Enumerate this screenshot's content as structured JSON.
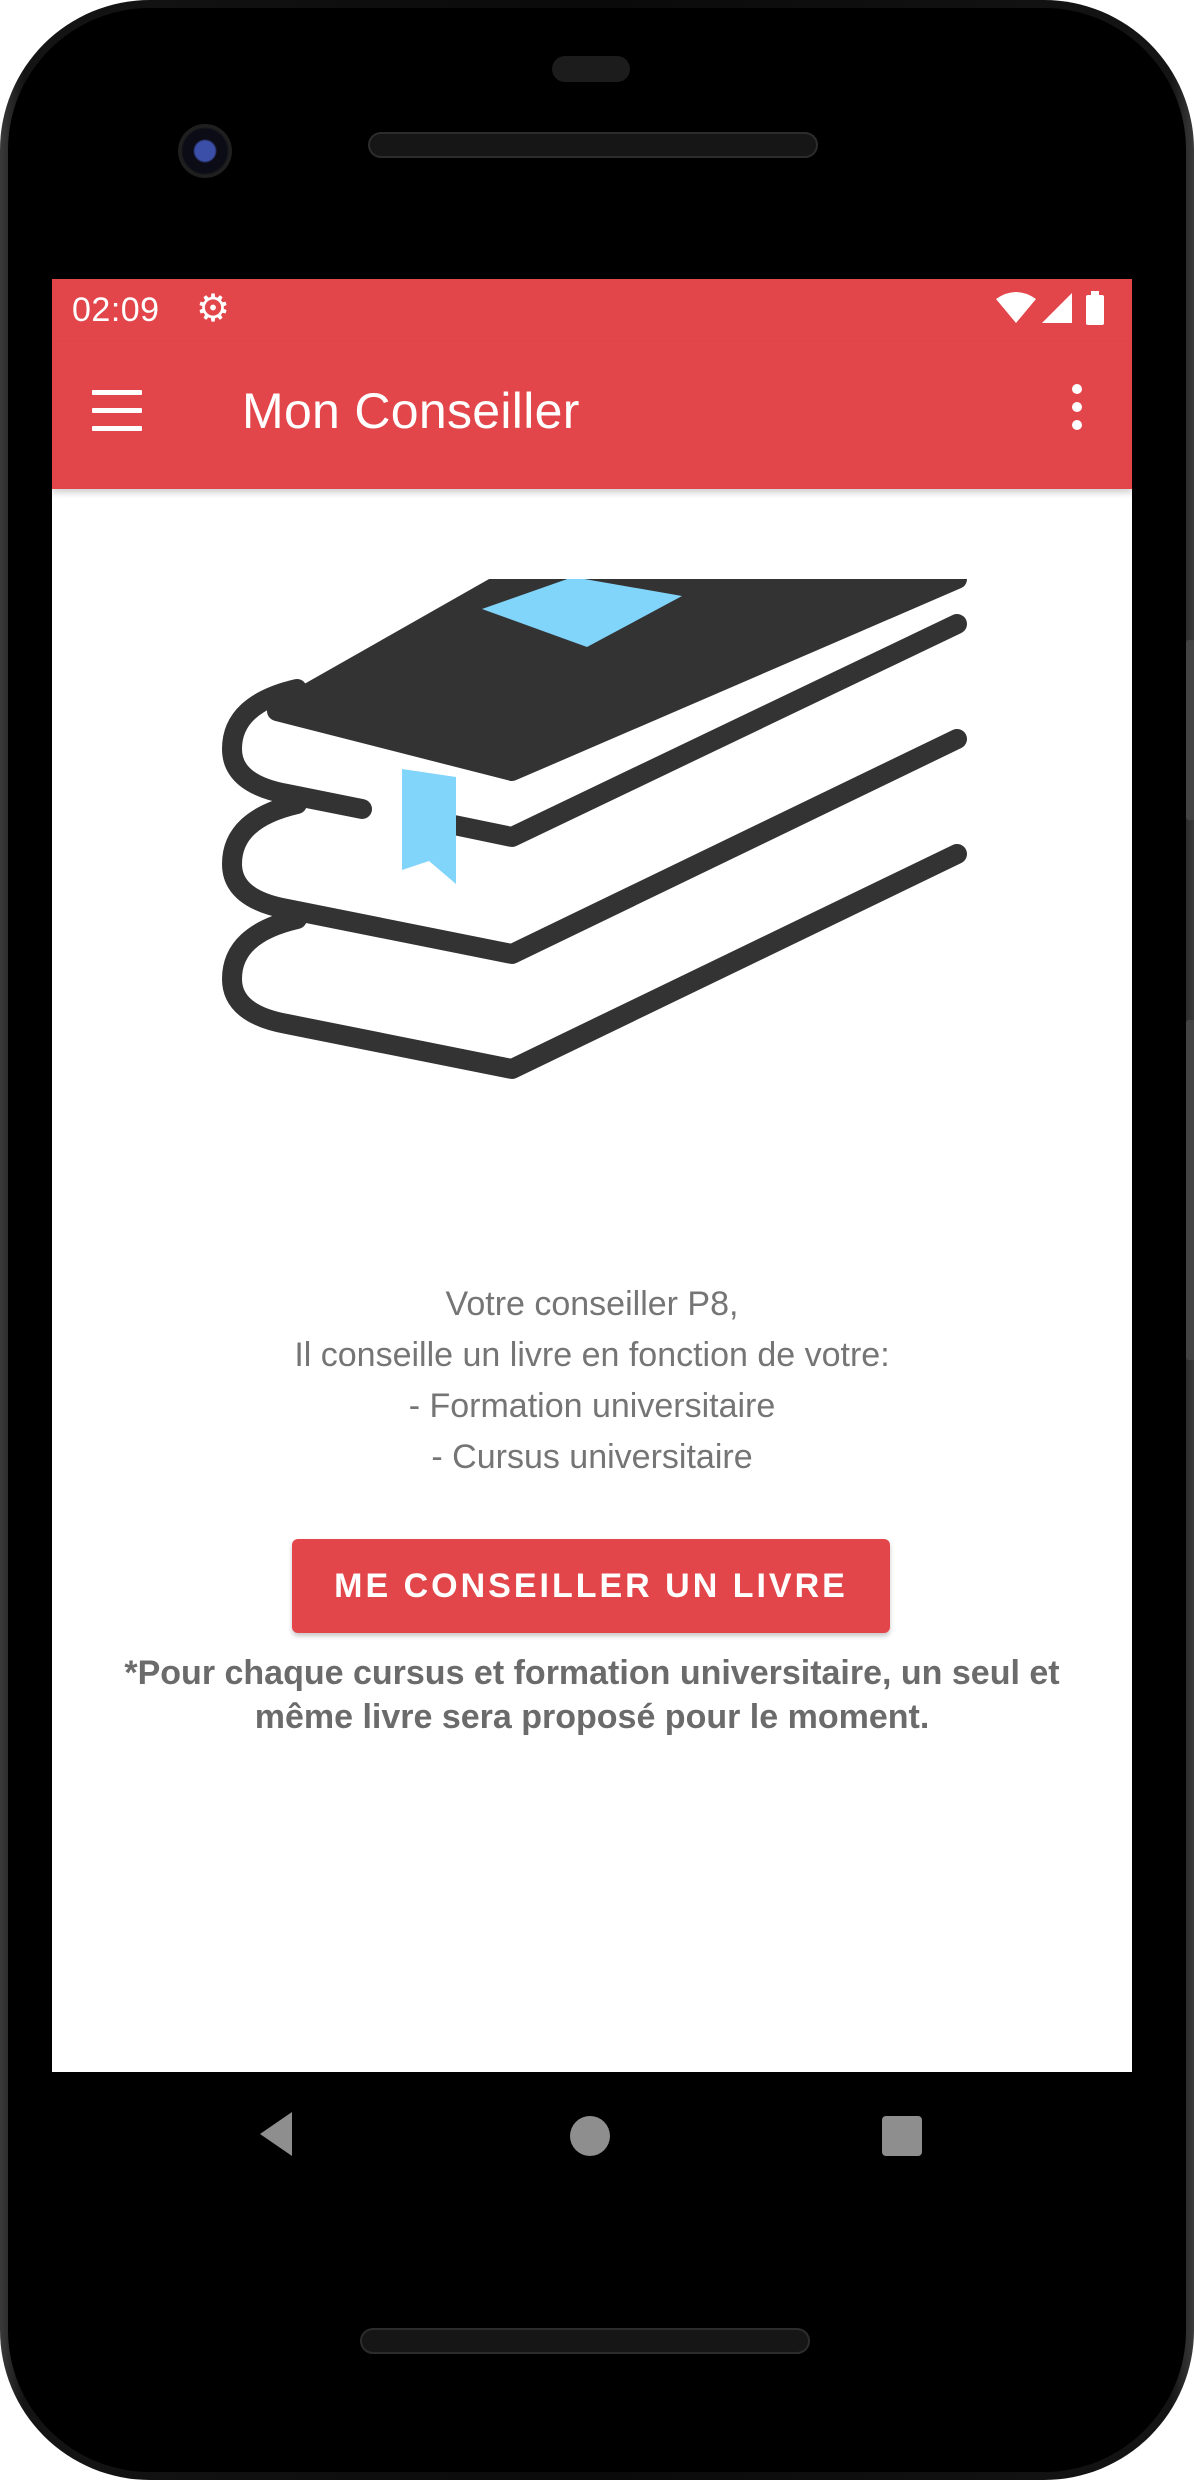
{
  "status_bar": {
    "time": "02:09",
    "icons": [
      "settings-icon",
      "wifi-icon",
      "signal-icon",
      "battery-icon"
    ]
  },
  "app_bar": {
    "title": "Mon Conseiller",
    "menu_icon": "hamburger-menu-icon",
    "overflow_icon": "more-vert-icon"
  },
  "content": {
    "illustration": "books-stack-icon",
    "description_lines": [
      "Votre conseiller P8,",
      "Il conseille un livre en fonction de votre:",
      "- Formation universitaire",
      "- Cursus universitaire"
    ],
    "button_label": "ME CONSEILLER UN LIVRE",
    "note": "*Pour chaque cursus et formation universitaire, un seul et même livre sera proposé pour le moment."
  },
  "nav_bar": {
    "icons": [
      "back-icon",
      "home-icon",
      "recents-icon"
    ]
  },
  "colors": {
    "primary": "#e3464a",
    "book_dark": "#333333",
    "book_accent": "#81d4fa",
    "text_secondary": "#757575"
  }
}
